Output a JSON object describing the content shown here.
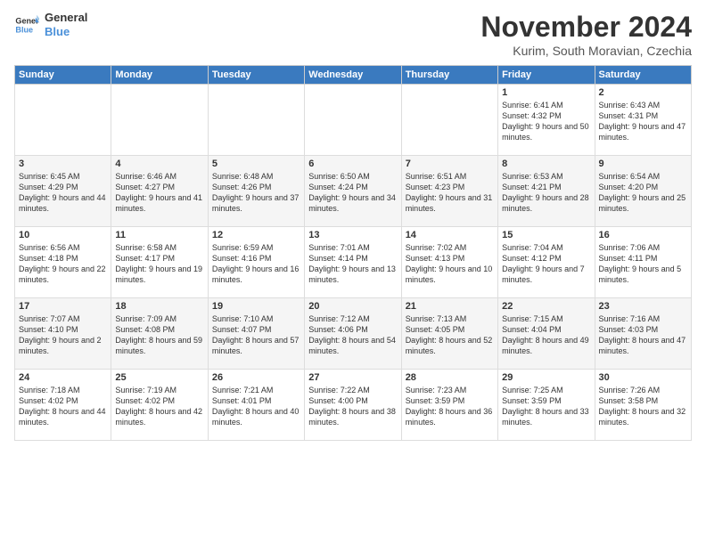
{
  "logo": {
    "line1": "General",
    "line2": "Blue"
  },
  "title": "November 2024",
  "subtitle": "Kurim, South Moravian, Czechia",
  "days_header": [
    "Sunday",
    "Monday",
    "Tuesday",
    "Wednesday",
    "Thursday",
    "Friday",
    "Saturday"
  ],
  "weeks": [
    [
      {
        "day": "",
        "content": ""
      },
      {
        "day": "",
        "content": ""
      },
      {
        "day": "",
        "content": ""
      },
      {
        "day": "",
        "content": ""
      },
      {
        "day": "",
        "content": ""
      },
      {
        "day": "1",
        "content": "Sunrise: 6:41 AM\nSunset: 4:32 PM\nDaylight: 9 hours and 50 minutes."
      },
      {
        "day": "2",
        "content": "Sunrise: 6:43 AM\nSunset: 4:31 PM\nDaylight: 9 hours and 47 minutes."
      }
    ],
    [
      {
        "day": "3",
        "content": "Sunrise: 6:45 AM\nSunset: 4:29 PM\nDaylight: 9 hours and 44 minutes."
      },
      {
        "day": "4",
        "content": "Sunrise: 6:46 AM\nSunset: 4:27 PM\nDaylight: 9 hours and 41 minutes."
      },
      {
        "day": "5",
        "content": "Sunrise: 6:48 AM\nSunset: 4:26 PM\nDaylight: 9 hours and 37 minutes."
      },
      {
        "day": "6",
        "content": "Sunrise: 6:50 AM\nSunset: 4:24 PM\nDaylight: 9 hours and 34 minutes."
      },
      {
        "day": "7",
        "content": "Sunrise: 6:51 AM\nSunset: 4:23 PM\nDaylight: 9 hours and 31 minutes."
      },
      {
        "day": "8",
        "content": "Sunrise: 6:53 AM\nSunset: 4:21 PM\nDaylight: 9 hours and 28 minutes."
      },
      {
        "day": "9",
        "content": "Sunrise: 6:54 AM\nSunset: 4:20 PM\nDaylight: 9 hours and 25 minutes."
      }
    ],
    [
      {
        "day": "10",
        "content": "Sunrise: 6:56 AM\nSunset: 4:18 PM\nDaylight: 9 hours and 22 minutes."
      },
      {
        "day": "11",
        "content": "Sunrise: 6:58 AM\nSunset: 4:17 PM\nDaylight: 9 hours and 19 minutes."
      },
      {
        "day": "12",
        "content": "Sunrise: 6:59 AM\nSunset: 4:16 PM\nDaylight: 9 hours and 16 minutes."
      },
      {
        "day": "13",
        "content": "Sunrise: 7:01 AM\nSunset: 4:14 PM\nDaylight: 9 hours and 13 minutes."
      },
      {
        "day": "14",
        "content": "Sunrise: 7:02 AM\nSunset: 4:13 PM\nDaylight: 9 hours and 10 minutes."
      },
      {
        "day": "15",
        "content": "Sunrise: 7:04 AM\nSunset: 4:12 PM\nDaylight: 9 hours and 7 minutes."
      },
      {
        "day": "16",
        "content": "Sunrise: 7:06 AM\nSunset: 4:11 PM\nDaylight: 9 hours and 5 minutes."
      }
    ],
    [
      {
        "day": "17",
        "content": "Sunrise: 7:07 AM\nSunset: 4:10 PM\nDaylight: 9 hours and 2 minutes."
      },
      {
        "day": "18",
        "content": "Sunrise: 7:09 AM\nSunset: 4:08 PM\nDaylight: 8 hours and 59 minutes."
      },
      {
        "day": "19",
        "content": "Sunrise: 7:10 AM\nSunset: 4:07 PM\nDaylight: 8 hours and 57 minutes."
      },
      {
        "day": "20",
        "content": "Sunrise: 7:12 AM\nSunset: 4:06 PM\nDaylight: 8 hours and 54 minutes."
      },
      {
        "day": "21",
        "content": "Sunrise: 7:13 AM\nSunset: 4:05 PM\nDaylight: 8 hours and 52 minutes."
      },
      {
        "day": "22",
        "content": "Sunrise: 7:15 AM\nSunset: 4:04 PM\nDaylight: 8 hours and 49 minutes."
      },
      {
        "day": "23",
        "content": "Sunrise: 7:16 AM\nSunset: 4:03 PM\nDaylight: 8 hours and 47 minutes."
      }
    ],
    [
      {
        "day": "24",
        "content": "Sunrise: 7:18 AM\nSunset: 4:02 PM\nDaylight: 8 hours and 44 minutes."
      },
      {
        "day": "25",
        "content": "Sunrise: 7:19 AM\nSunset: 4:02 PM\nDaylight: 8 hours and 42 minutes."
      },
      {
        "day": "26",
        "content": "Sunrise: 7:21 AM\nSunset: 4:01 PM\nDaylight: 8 hours and 40 minutes."
      },
      {
        "day": "27",
        "content": "Sunrise: 7:22 AM\nSunset: 4:00 PM\nDaylight: 8 hours and 38 minutes."
      },
      {
        "day": "28",
        "content": "Sunrise: 7:23 AM\nSunset: 3:59 PM\nDaylight: 8 hours and 36 minutes."
      },
      {
        "day": "29",
        "content": "Sunrise: 7:25 AM\nSunset: 3:59 PM\nDaylight: 8 hours and 33 minutes."
      },
      {
        "day": "30",
        "content": "Sunrise: 7:26 AM\nSunset: 3:58 PM\nDaylight: 8 hours and 32 minutes."
      }
    ]
  ]
}
